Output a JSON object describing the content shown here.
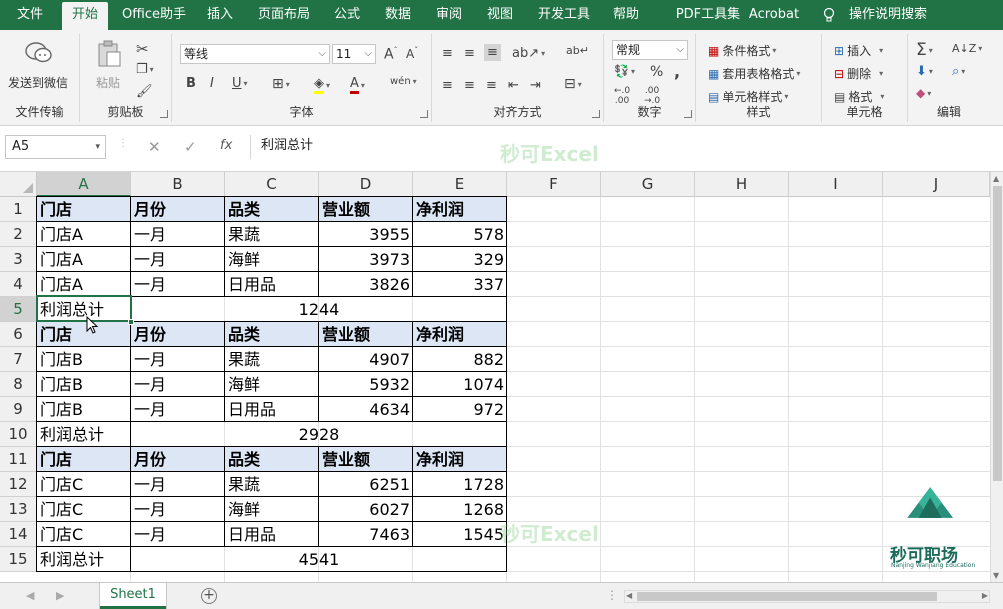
{
  "menu": [
    "文件",
    "开始",
    "Office助手",
    "插入",
    "页面布局",
    "公式",
    "数据",
    "审阅",
    "视图",
    "开发工具",
    "帮助",
    "PDF工具集",
    "Acrobat",
    "操作说明搜索"
  ],
  "ribbon": {
    "groups": [
      "文件传输",
      "剪贴板",
      "字体",
      "对齐方式",
      "数字",
      "样式",
      "单元格",
      "编辑"
    ],
    "send_wechat": "发送到微信",
    "paste": "粘贴",
    "font_name": "等线",
    "font_size": "11",
    "number_format": "常规",
    "cond_format": "条件格式",
    "table_format": "套用表格格式",
    "cell_style": "单元格样式",
    "insert": "插入",
    "delete": "删除",
    "format": "格式",
    "bold": "B",
    "italic": "I",
    "underline": "U",
    "percent": "%",
    "comma": ","
  },
  "formula_bar": {
    "name_box": "A5",
    "content": "利润总计",
    "fx": "fx",
    "watermark": "秒可Excel"
  },
  "columns": [
    "A",
    "B",
    "C",
    "D",
    "E",
    "F",
    "G",
    "H",
    "I",
    "J"
  ],
  "rows": [
    "1",
    "2",
    "3",
    "4",
    "5",
    "6",
    "7",
    "8",
    "9",
    "10",
    "11",
    "12",
    "13",
    "14",
    "15"
  ],
  "table": {
    "header": [
      "门店",
      "月份",
      "品类",
      "营业额",
      "净利润"
    ],
    "blocks": [
      {
        "rows": [
          [
            "门店A",
            "一月",
            "果蔬",
            "3955",
            "578"
          ],
          [
            "门店A",
            "一月",
            "海鲜",
            "3973",
            "329"
          ],
          [
            "门店A",
            "一月",
            "日用品",
            "3826",
            "337"
          ]
        ],
        "total_label": "利润总计",
        "total": "1244"
      },
      {
        "rows": [
          [
            "门店B",
            "一月",
            "果蔬",
            "4907",
            "882"
          ],
          [
            "门店B",
            "一月",
            "海鲜",
            "5932",
            "1074"
          ],
          [
            "门店B",
            "一月",
            "日用品",
            "4634",
            "972"
          ]
        ],
        "total_label": "利润总计",
        "total": "2928"
      },
      {
        "rows": [
          [
            "门店C",
            "一月",
            "果蔬",
            "6251",
            "1728"
          ],
          [
            "门店C",
            "一月",
            "海鲜",
            "6027",
            "1268"
          ],
          [
            "门店C",
            "一月",
            "日用品",
            "7463",
            "1545"
          ]
        ],
        "total_label": "利润总计",
        "total": "4541"
      }
    ]
  },
  "sheet_tab": "Sheet1",
  "logo_text": "秒可职场",
  "logo_sub": "Nanjing Wanjiang Education",
  "colors": {
    "excel_green": "#217346",
    "header_fill": "#dce6f4"
  }
}
